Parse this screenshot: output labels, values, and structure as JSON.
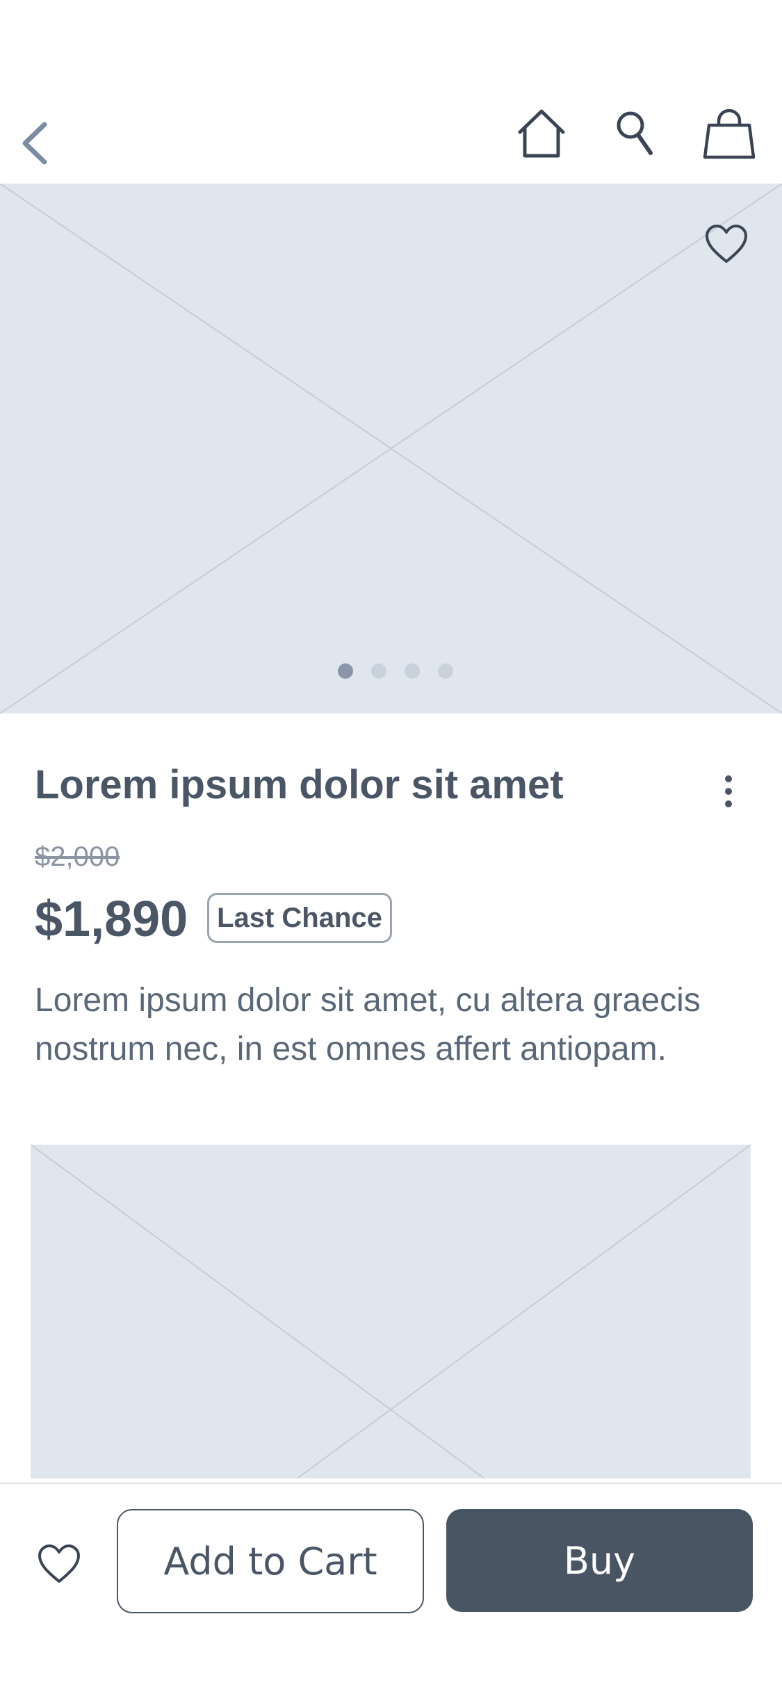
{
  "nav": {
    "back_icon": "chevron-left-icon",
    "home_icon": "home-icon",
    "search_icon": "search-icon",
    "bag_icon": "shopping-bag-icon"
  },
  "hero": {
    "favorite_icon": "heart-icon",
    "carousel_pages": 4,
    "active_page": 1
  },
  "product": {
    "title": "Lorem ipsum dolor sit amet",
    "more_icon": "more-vertical-icon",
    "original_price": "$2,000",
    "price": "$1,890",
    "badge": "Last Chance",
    "description": "Lorem ipsum dolor sit amet, cu altera graecis nostrum nec, in est omnes affert antiopam."
  },
  "actions": {
    "favorite_icon": "heart-icon",
    "add_to_cart_label": "Add to Cart",
    "buy_label": "Buy"
  },
  "colors": {
    "primary": "#4a5563",
    "text": "#4a5565",
    "placeholder": "#e0e6ee",
    "dot_active": "#8a96a8",
    "dot_inactive": "#c9d1dc"
  }
}
